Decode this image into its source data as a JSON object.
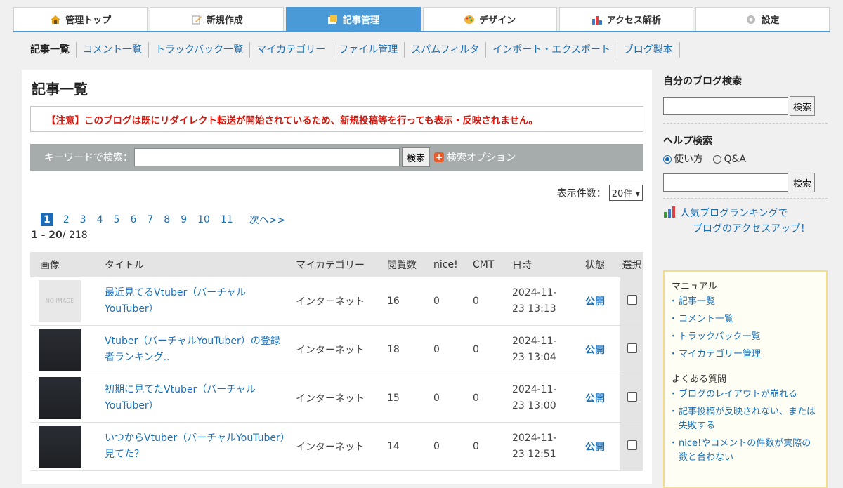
{
  "topnav": [
    {
      "label": "管理トップ",
      "icon": "home-icon"
    },
    {
      "label": "新規作成",
      "icon": "pencil-icon"
    },
    {
      "label": "記事管理",
      "icon": "article-icon"
    },
    {
      "label": "デザイン",
      "icon": "palette-icon"
    },
    {
      "label": "アクセス解析",
      "icon": "bar-chart-icon"
    },
    {
      "label": "設定",
      "icon": "gear-icon"
    }
  ],
  "subnav": [
    "記事一覧",
    "コメント一覧",
    "トラックバック一覧",
    "マイカテゴリー",
    "ファイル管理",
    "スパムフィルタ",
    "インポート・エクスポート",
    "ブログ製本"
  ],
  "page_title": "記事一覧",
  "notice": "【注意】このブログは既にリダイレクト転送が開始されているため、新規投稿等を行っても表示・反映されません。",
  "search": {
    "label": "キーワードで検索：",
    "button": "検索",
    "option": "検索オプション"
  },
  "perpage": {
    "label": "表示件数：",
    "value": "20件"
  },
  "pager": {
    "current": "1",
    "pages": [
      "2",
      "3",
      "4",
      "5",
      "6",
      "7",
      "8",
      "9",
      "10",
      "11"
    ],
    "next": "次へ>>"
  },
  "range": {
    "from_to": "1 - 20",
    "total": "/ 218"
  },
  "table": {
    "headers": [
      "画像",
      "タイトル",
      "マイカテゴリー",
      "閲覧数",
      "nice!",
      "CMT",
      "日時",
      "状態",
      "選択"
    ],
    "rows": [
      {
        "image": "NO IMAGE",
        "title": "最近見てるVtuber（バーチャルYouTuber）",
        "category": "インターネット",
        "views": "16",
        "nice": "0",
        "cmt": "0",
        "date": "2024-11-",
        "time": "23 13:13",
        "status": "公開"
      },
      {
        "image": "",
        "title": "Vtuber（バーチャルYouTuber）の登録者ランキング..",
        "category": "インターネット",
        "views": "18",
        "nice": "0",
        "cmt": "0",
        "date": "2024-11-",
        "time": "23 13:04",
        "status": "公開"
      },
      {
        "image": "",
        "title": "初期に見てたVtuber（バーチャルYouTuber）",
        "category": "インターネット",
        "views": "15",
        "nice": "0",
        "cmt": "0",
        "date": "2024-11-",
        "time": "23 13:00",
        "status": "公開"
      },
      {
        "image": "",
        "title": "いつからVtuber（バーチャルYouTuber）見てた？",
        "category": "インターネット",
        "views": "14",
        "nice": "0",
        "cmt": "0",
        "date": "2024-11-",
        "time": "23 12:51",
        "status": "公開"
      }
    ]
  },
  "sidebar": {
    "blog_search_title": "自分のブログ検索",
    "search_button": "検索",
    "help_title": "ヘルプ検索",
    "radio1": "使い方",
    "radio2": "Q&A",
    "rank_line1": "人気ブログランキングで",
    "rank_line2": "ブログのアクセスアップ！",
    "manual_title": "マニュアル",
    "manual_links": [
      "記事一覧",
      "コメント一覧",
      "トラックバック一覧",
      "マイカテゴリー管理"
    ],
    "faq_title": "よくある質問",
    "faq_links": [
      "ブログのレイアウトが崩れる",
      "記事投稿が反映されない、または失敗する",
      "nice!やコメントの件数が実際の数と合わない"
    ]
  }
}
